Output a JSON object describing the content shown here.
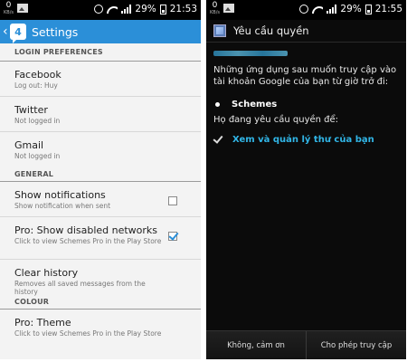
{
  "left_status": {
    "net_top": "0",
    "net_bottom": "KB/s",
    "battery": "29%",
    "time": "21:53"
  },
  "right_status": {
    "net_top": "0",
    "net_bottom": "KB/s",
    "battery": "29%",
    "time": "21:55"
  },
  "settings": {
    "title": "Settings",
    "badge": "4",
    "categories": {
      "login": "LOGIN PREFERENCES",
      "general": "GENERAL",
      "colour": "COLOUR"
    },
    "items": {
      "facebook": {
        "title": "Facebook",
        "summary": "Log out: Huy"
      },
      "twitter": {
        "title": "Twitter",
        "summary": "Not logged in"
      },
      "gmail": {
        "title": "Gmail",
        "summary": "Not logged in"
      },
      "notifications": {
        "title": "Show notifications",
        "summary": "Show notification when sent",
        "checked": false
      },
      "disabled_networks": {
        "title": "Pro: Show disabled networks",
        "summary": "Click to view Schemes Pro in the Play Store",
        "checked": true
      },
      "clear_history": {
        "title": "Clear history",
        "summary": "Removes all saved messages from the history"
      },
      "theme": {
        "title": "Pro: Theme",
        "summary": "Click to view Schemes Pro in the Play Store"
      }
    },
    "accent_color": "#2b8fd8"
  },
  "permission": {
    "title": "Yêu cầu quyền",
    "body": "Những ứng dụng sau muốn truy cập vào tài khoản Google của bạn từ giờ trở đi:",
    "app": "Schemes",
    "request_label": "Họ đang yêu cầu quyền để:",
    "permission_item": "Xem và quản lý thư của bạn",
    "deny_button": "Không, cảm ơn",
    "allow_button": "Cho phép truy cập",
    "link_color": "#31b6e7"
  }
}
